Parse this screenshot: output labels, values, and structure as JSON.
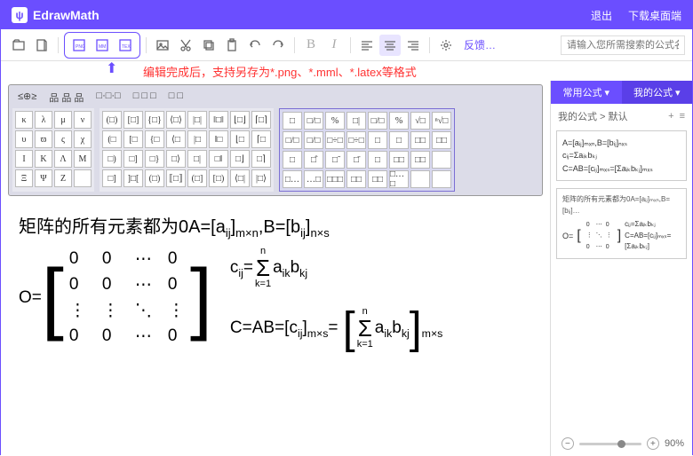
{
  "header": {
    "brand": "EdrawMath",
    "logo_glyph": "ψ",
    "exit": "退出",
    "download": "下载桌面端"
  },
  "toolbar": {
    "feedback": "反馈…",
    "search_placeholder": "请输入您所需搜索的公式名称"
  },
  "hint": {
    "text": "编辑完成后，支持另存为*.png、*.mml、*.latex等格式"
  },
  "palette": {
    "tabs": [
      "≤⊕≥",
      "品 品 品",
      "□·□·□",
      "□ □ □",
      "□ □"
    ],
    "grid1": [
      "κ",
      "λ",
      "μ",
      "ν",
      "υ",
      "ϖ",
      "ς",
      "χ",
      "Ι",
      "Κ",
      "Λ",
      "Μ",
      "Ξ",
      "Ψ",
      "Ζ",
      ""
    ],
    "grid2": [
      "(□)",
      "[□]",
      "{□}",
      "⟨□⟩",
      "|□|",
      "‖□‖",
      "⌊□⌋",
      "⌈□⌉",
      "(□",
      "[□",
      "{□",
      "⟨□",
      "|□",
      "‖□",
      "⌊□",
      "⌈□",
      "□)",
      "□]",
      "□}",
      "□⟩",
      "□|",
      "□‖",
      "□⌋",
      "□⌉",
      "□]",
      "]□[",
      "(□)",
      "⟦□⟧",
      "(□]",
      "[□)",
      "⟨□|",
      "|□⟩"
    ],
    "grid3": [
      "□",
      "□/□",
      "%",
      "□|",
      "□/□",
      "%",
      "√□",
      "ⁿ√□",
      "□/□",
      "□/□",
      "□÷□",
      "□÷□",
      "□",
      "□",
      "□□",
      "□□",
      "□",
      "□̂",
      "□̃",
      "□̄",
      "□",
      "□□",
      "□□",
      "",
      "□…",
      "…□",
      "□□□",
      "□□",
      "□□",
      "□…□",
      "",
      ""
    ]
  },
  "editor": {
    "line1_prefix": "矩阵的所有元素都为0",
    "line1_a": "A=[a",
    "line1_a_dim": "m×n",
    "line1_b": ",B=[b",
    "line1_b_dim": "n×s",
    "o_eq": "O=",
    "matrix_cells": [
      "0",
      "0",
      "⋯",
      "0",
      "0",
      "0",
      "⋯",
      "0",
      "⋮",
      "⋮",
      "⋱",
      "⋮",
      "0",
      "0",
      "⋯",
      "0"
    ],
    "cij": "c",
    "sum_top": "n",
    "sum_bot": "k=1",
    "aik_bkj": "a",
    "cab_left": "C=AB=[c",
    "cab_dim": "m×s",
    "eq": "="
  },
  "sidebar": {
    "tab1": "常用公式",
    "tab2": "我的公式",
    "breadcrumb": "我的公式 > 默认",
    "card1": {
      "l1": "A=[aᵢⱼ]ₘₓₙ,B=[bᵢⱼ]ₙₓₛ",
      "l2": "cᵢⱼ=Σaᵢₖbₖⱼ",
      "l3": "C=AB=[cᵢⱼ]ₘₓₛ=[Σaᵢₖbₖⱼ]ₘₓₛ"
    },
    "card2": {
      "title": "矩阵的所有元素都为0A=[aᵢⱼ]ₘₓₙ,B=[bᵢⱼ]…",
      "l1": "O=",
      "l2": "cᵢⱼ=Σaᵢₖbₖⱼ",
      "l3": "C=AB=[cᵢⱼ]ₘₓₛ=[Σaᵢₖbₖⱼ]"
    }
  },
  "zoom": {
    "value": "90%"
  }
}
